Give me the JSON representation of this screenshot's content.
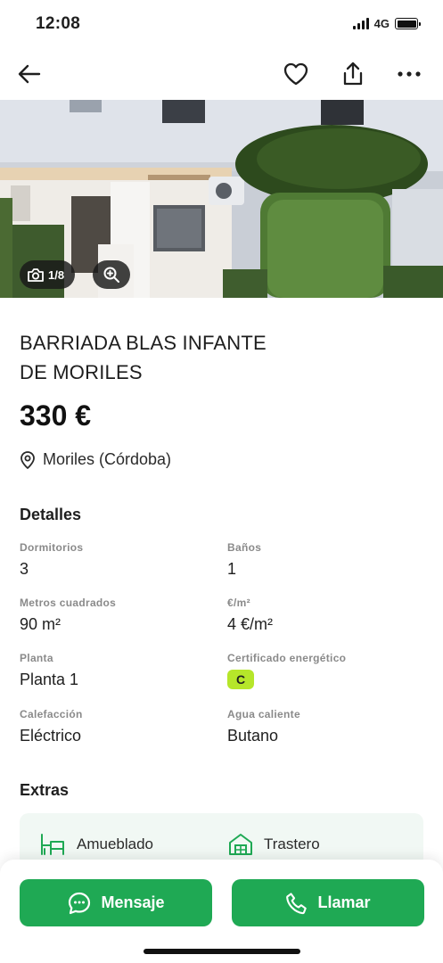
{
  "status_bar": {
    "time": "12:08",
    "network": "4G"
  },
  "nav": {
    "back_icon": "arrow-left-icon",
    "favorite_icon": "heart-icon",
    "share_icon": "share-icon",
    "more_icon": "more-horizontal-icon"
  },
  "gallery": {
    "counter": "1/8",
    "camera_icon": "camera-icon",
    "zoom_icon": "zoom-in-icon"
  },
  "listing": {
    "title_line1": "BARRIADA BLAS INFANTE",
    "title_line2": "DE MORILES",
    "price": "330 €",
    "location": "Moriles (Córdoba)",
    "location_icon": "location-pin-icon"
  },
  "details": {
    "title": "Detalles",
    "items": [
      {
        "label": "Dormitorios",
        "value": "3"
      },
      {
        "label": "Baños",
        "value": "1"
      },
      {
        "label": "Metros cuadrados",
        "value": "90 m²"
      },
      {
        "label": "€/m²",
        "value": "4 €/m²"
      },
      {
        "label": "Planta",
        "value": "Planta 1"
      },
      {
        "label": "Certificado energético",
        "value": "C"
      },
      {
        "label": "Calefacción",
        "value": "Eléctrico"
      },
      {
        "label": "Agua caliente",
        "value": "Butano"
      }
    ]
  },
  "extras": {
    "title": "Extras",
    "items": [
      {
        "label": "Amueblado",
        "icon": "furniture-icon"
      },
      {
        "label": "Trastero",
        "icon": "storage-room-icon"
      }
    ]
  },
  "actions": {
    "message_label": "Mensaje",
    "call_label": "Llamar"
  },
  "colors": {
    "brand_green": "#1fa954",
    "energy_c": "#b6e62a",
    "extras_bg": "#f1f8f4"
  }
}
